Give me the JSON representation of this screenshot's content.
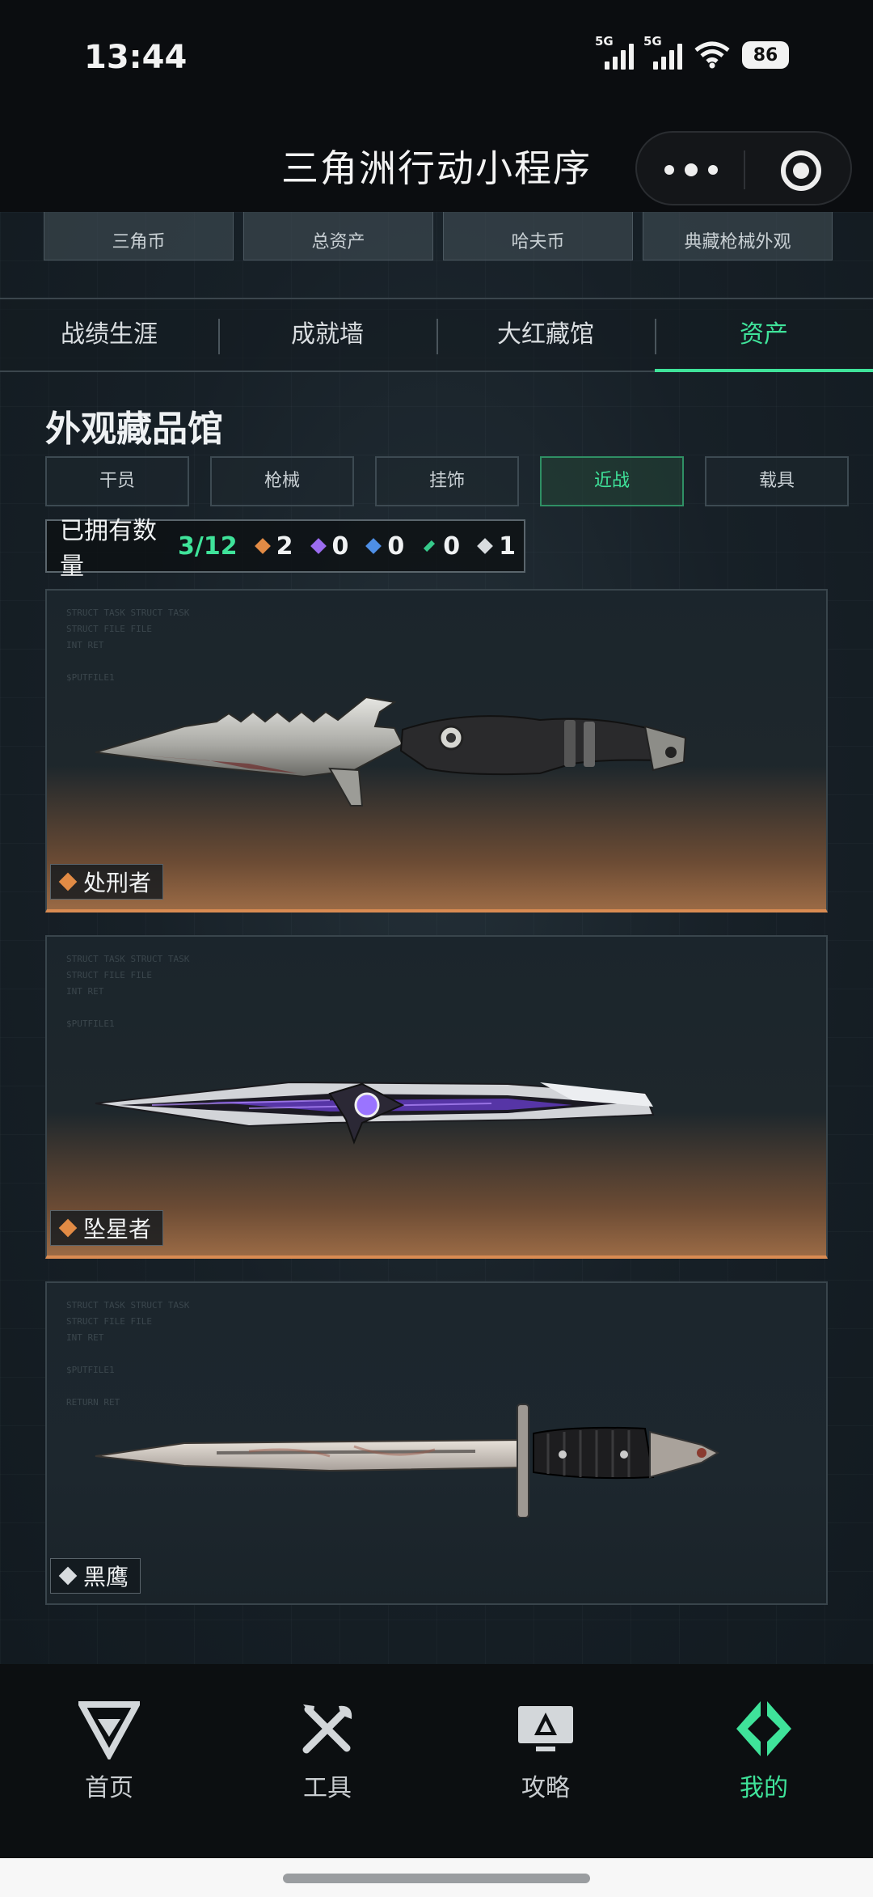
{
  "status_bar": {
    "time": "13:44",
    "signal1_label": "5G",
    "signal2_label": "5G",
    "battery": "86"
  },
  "header": {
    "title": "三角洲行动小程序"
  },
  "stats": [
    {
      "label": "三角币"
    },
    {
      "label": "总资产"
    },
    {
      "label": "哈夫币"
    },
    {
      "label": "典藏枪械外观"
    }
  ],
  "tabs": [
    {
      "label": "战绩生涯"
    },
    {
      "label": "成就墙"
    },
    {
      "label": "大红藏馆"
    },
    {
      "label": "资产"
    }
  ],
  "gallery": {
    "title": "外观藏品馆",
    "filters": [
      "干员",
      "枪械",
      "挂饰",
      "近战",
      "载具"
    ],
    "owned_label": "已拥有数量",
    "owned_value": "3/12",
    "rarity_counts": [
      {
        "color": "gold",
        "count": "2"
      },
      {
        "color": "purple",
        "count": "0"
      },
      {
        "color": "blue",
        "count": "0"
      },
      {
        "color": "green",
        "count": "0"
      },
      {
        "color": "white",
        "count": "1"
      }
    ],
    "items": [
      {
        "name": "处刑者",
        "rarity": "gold"
      },
      {
        "name": "坠星者",
        "rarity": "gold"
      },
      {
        "name": "黑鹰",
        "rarity": "white"
      }
    ]
  },
  "nav": [
    {
      "label": "首页",
      "icon": "delta-logo-icon"
    },
    {
      "label": "工具",
      "icon": "tools-icon"
    },
    {
      "label": "攻略",
      "icon": "guide-monitor-icon"
    },
    {
      "label": "我的",
      "icon": "profile-emblem-icon"
    }
  ],
  "colors": {
    "accent": "#3fe39a",
    "gold": "#e28b45",
    "purple": "#9b6cf0",
    "blue": "#4e8fe6",
    "green": "#36c98a"
  }
}
